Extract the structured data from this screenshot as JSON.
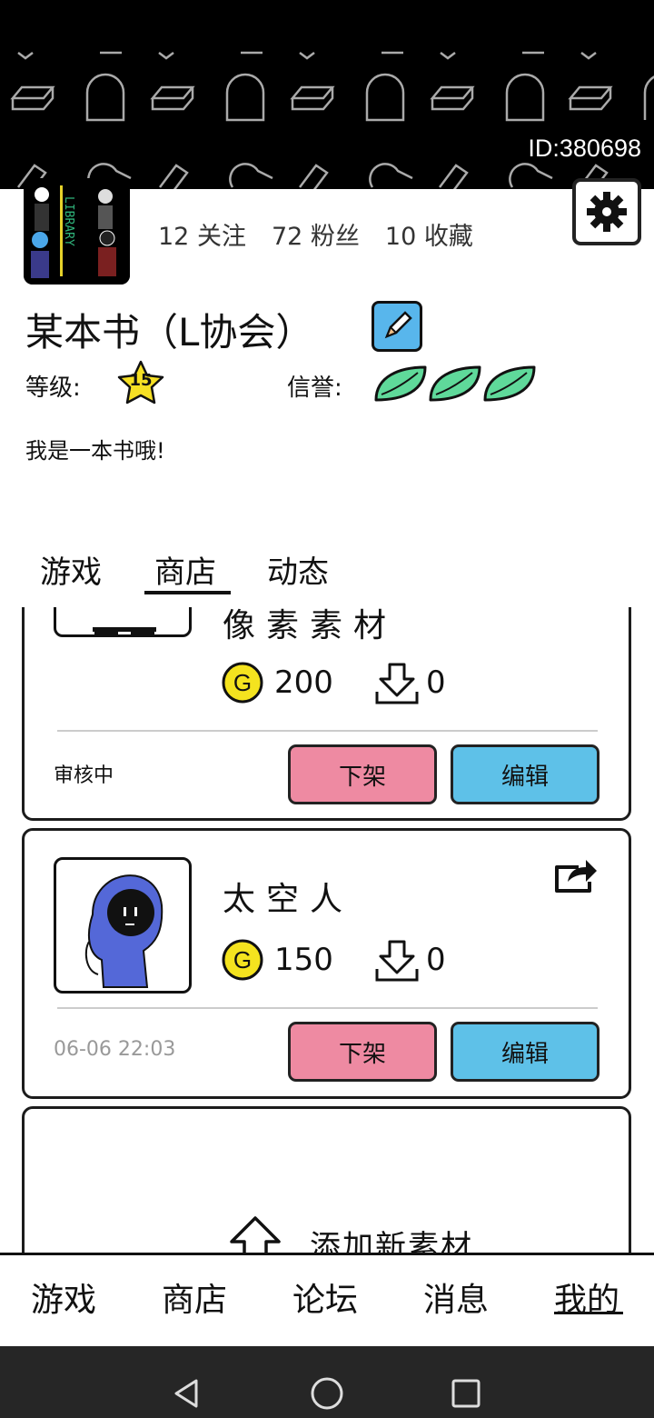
{
  "profile": {
    "id_text": "ID:380698",
    "stats": {
      "follow": "12 关注",
      "fans": "72 粉丝",
      "favorites": "10 收藏"
    },
    "username": "某本书（L协会）",
    "level_label": "等级:",
    "level_value": "15",
    "credit_label": "信誉:",
    "credit_leaves": 3,
    "bio": "我是一本书哦!",
    "avatar_text": "LIBRARY"
  },
  "profile_tabs": {
    "games": "游戏",
    "store": "商店",
    "activity": "动态",
    "selected": "商店"
  },
  "items": [
    {
      "title": "像素素材",
      "price": "200",
      "downloads": "0",
      "status": "审核中",
      "btn_delist": "下架",
      "btn_edit": "编辑"
    },
    {
      "title": "太空人",
      "price": "150",
      "downloads": "0",
      "status": "06-06 22:03",
      "btn_delist": "下架",
      "btn_edit": "编辑"
    }
  ],
  "add_new": "添加新素材",
  "coin_letter": "G",
  "bottom_nav": {
    "games": "游戏",
    "store": "商店",
    "forum": "论坛",
    "messages": "消息",
    "mine": "我的",
    "selected": "我的"
  },
  "colors": {
    "pink_button": "#ee8aa2",
    "blue_button": "#5ec1e8",
    "coin": "#f4e31f",
    "leaf": "#5fd99a"
  }
}
